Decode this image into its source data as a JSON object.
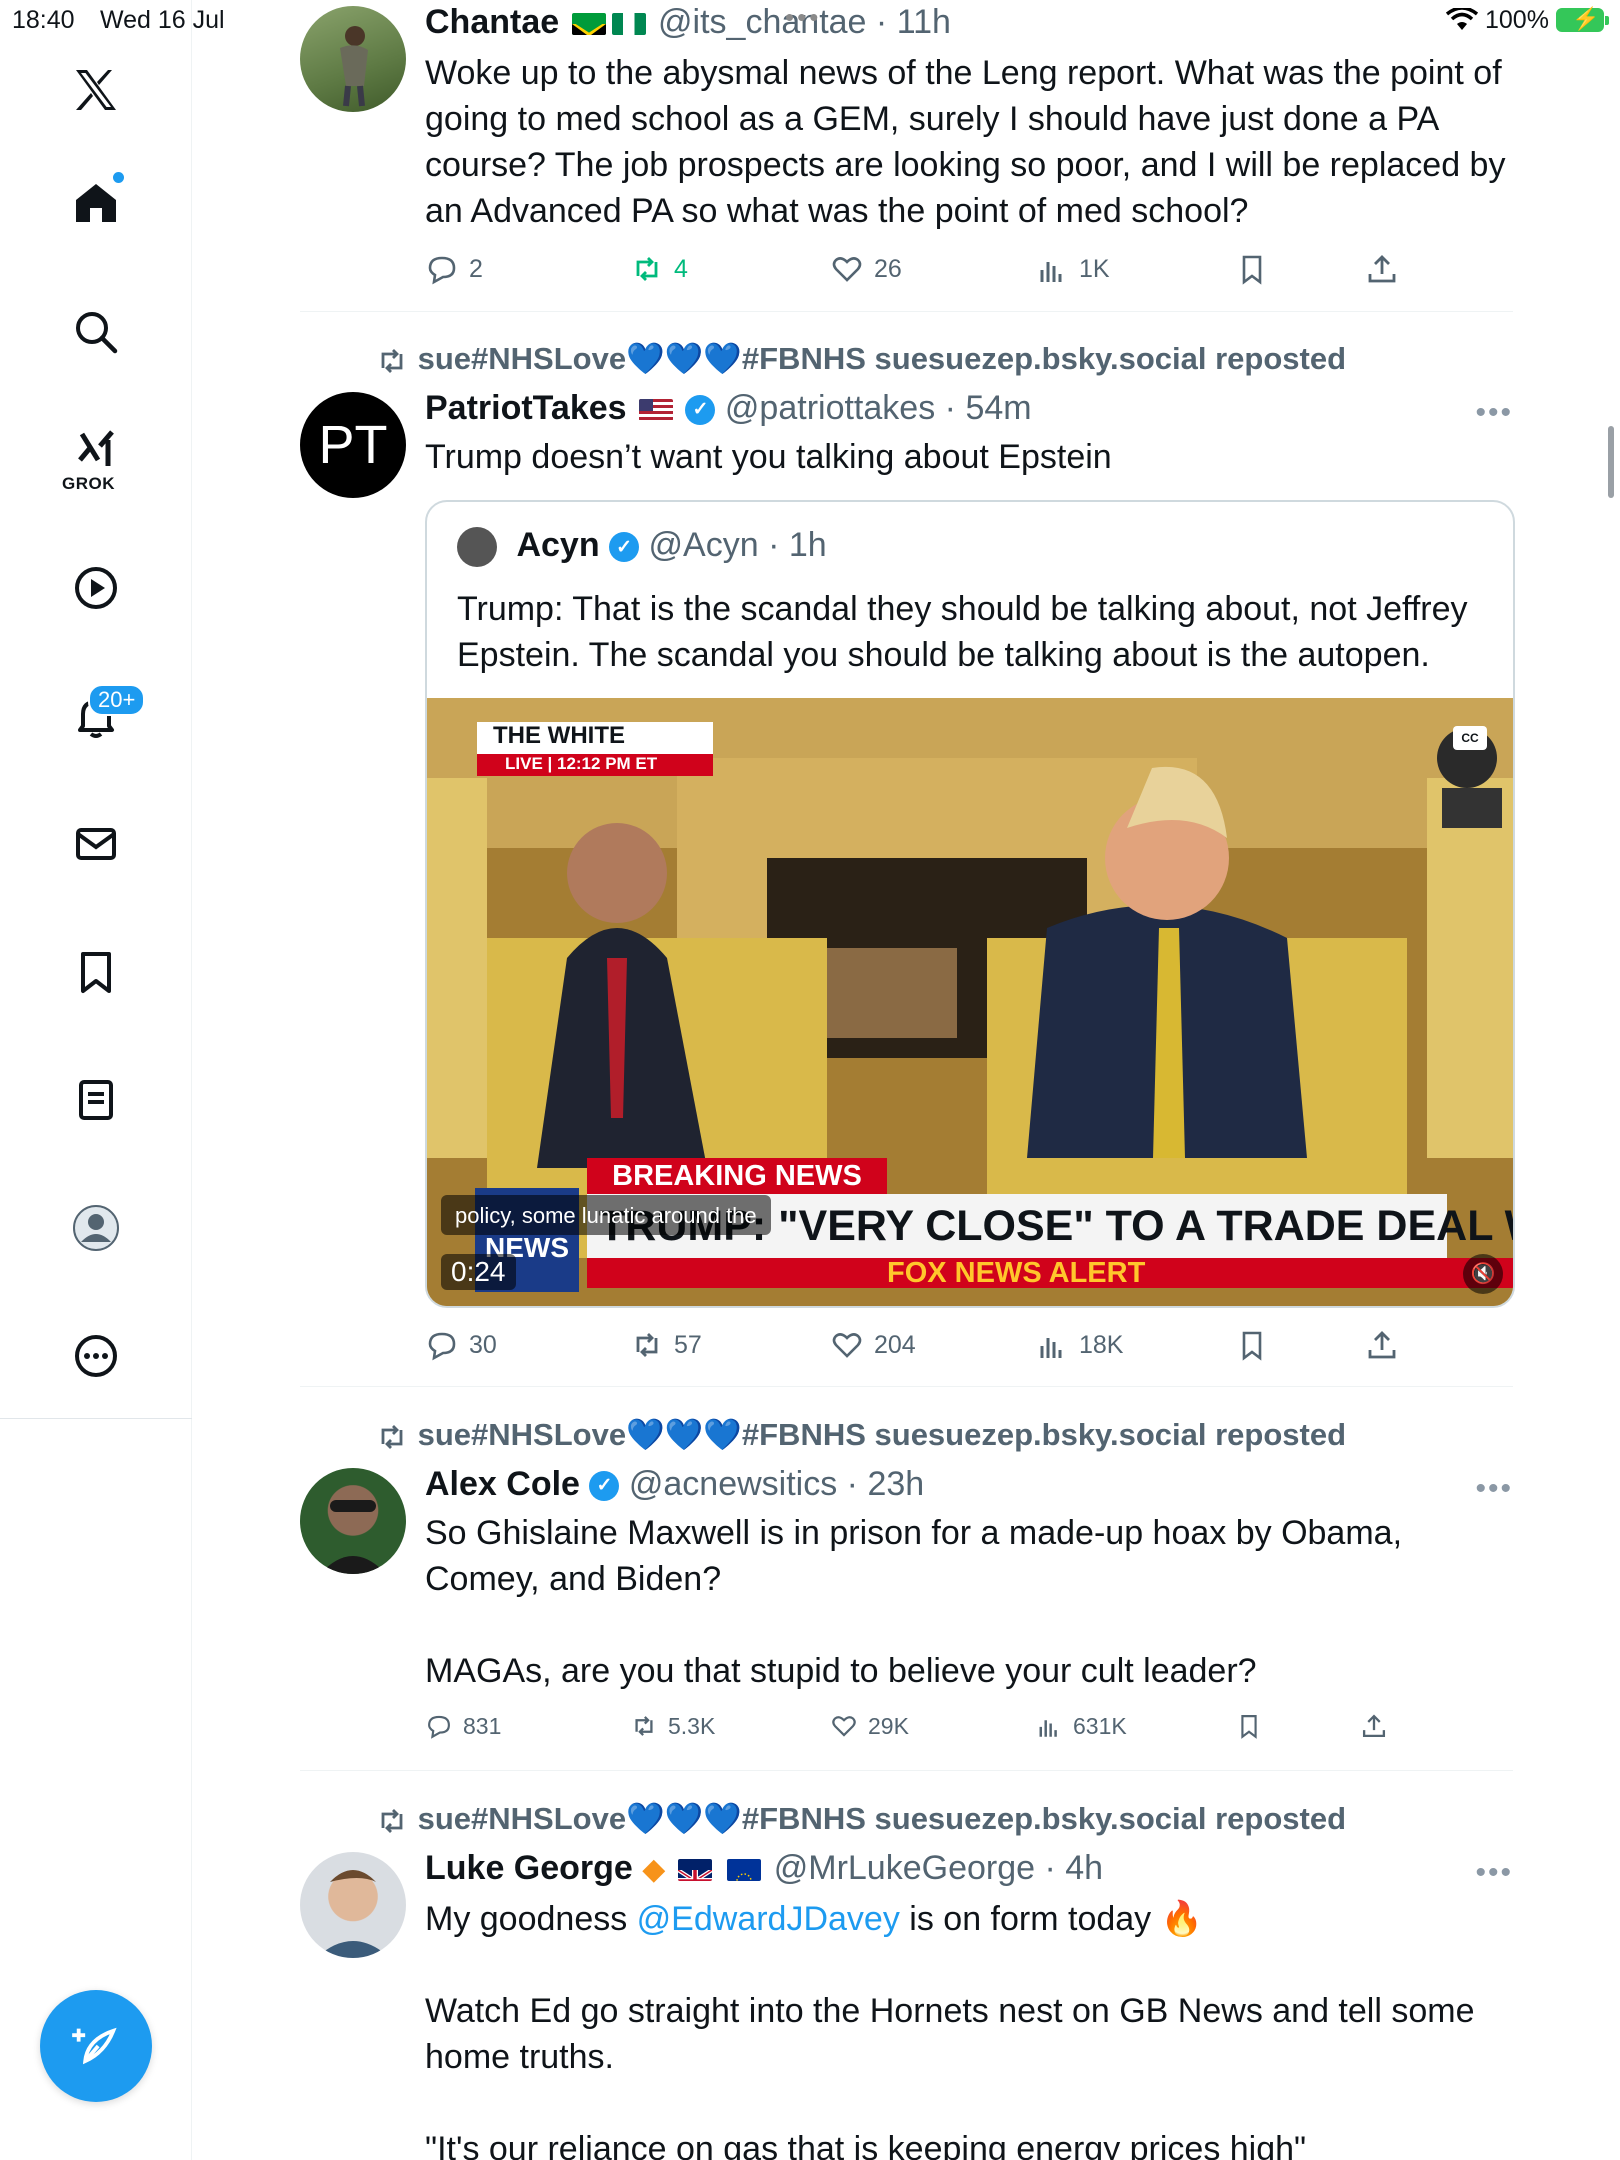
{
  "status_bar": {
    "time": "18:40",
    "date": "Wed 16 Jul",
    "battery": "100%"
  },
  "sidebar": {
    "grok_label": "GROK",
    "notifications_badge": "20+",
    "items": [
      "x-logo",
      "home",
      "search",
      "grok",
      "video",
      "notifications",
      "messages",
      "bookmarks",
      "lists",
      "profile",
      "more"
    ]
  },
  "tweets": [
    {
      "name": "Chantae",
      "handle": "@its_chantae",
      "time": "11h",
      "text": "Woke up to the abysmal news of the Leng report. What was the point of going to med school as a GEM, surely I should have just done a PA course? The job prospects are looking so poor, and I will be replaced by an Advanced PA so what was the point of med school?",
      "replies": "2",
      "reposts": "4",
      "likes": "26",
      "views": "1K"
    },
    {
      "repost_by": "sue#NHSLove💙💙💙#FBNHS suesuezep.bsky.social reposted",
      "name": "PatriotTakes",
      "handle": "@patriottakes",
      "time": "54m",
      "avatar_text": "PT",
      "text": "Trump doesn’t want you talking about Epstein",
      "quote": {
        "name": "Acyn",
        "handle": "@Acyn",
        "time": "1h",
        "text": "Trump: That is the scandal they should be talking about, not Jeffrey Epstein. The scandal you should be talking about is the autopen.",
        "video": {
          "cc": "CC",
          "wh_top": "THE WHITE HOUSE",
          "wh_live": "LIVE  |  12:12 PM ET",
          "breaking": "BREAKING NEWS",
          "headline": "TRUMP: \"VERY CLOSE\" TO A TRADE DEAL WITH INDIA",
          "alert": "FOX NEWS ALERT",
          "logo": "NEWS",
          "caption": "policy, some lunatic around the",
          "duration": "0:24"
        }
      },
      "replies": "30",
      "reposts": "57",
      "likes": "204",
      "views": "18K"
    },
    {
      "repost_by": "sue#NHSLove💙💙💙#FBNHS suesuezep.bsky.social reposted",
      "name": "Alex Cole",
      "handle": "@acnewsitics",
      "time": "23h",
      "text_lines": [
        "So Ghislaine Maxwell is in prison for a made-up hoax by Obama, Comey, and Biden?",
        "MAGAs, are you that stupid to believe your cult leader?"
      ],
      "replies": "831",
      "reposts": "5.3K",
      "likes": "29K",
      "views": "631K"
    },
    {
      "repost_by": "sue#NHSLove💙💙💙#FBNHS suesuezep.bsky.social reposted",
      "name": "Luke George",
      "handle": "@MrLukeGeorge",
      "time": "4h",
      "text_pre": "My goodness ",
      "mention": "@EdwardJDavey",
      "text_post": " is on form today 🔥",
      "text2": "Watch Ed go straight into the Hornets nest on GB News and tell some home truths.",
      "text3": "\"It's our reliance on gas that is keeping energy prices high\""
    }
  ],
  "colors": {
    "accent": "#1d9bf0",
    "muted": "#536471",
    "repost_green": "#00ba7c"
  }
}
